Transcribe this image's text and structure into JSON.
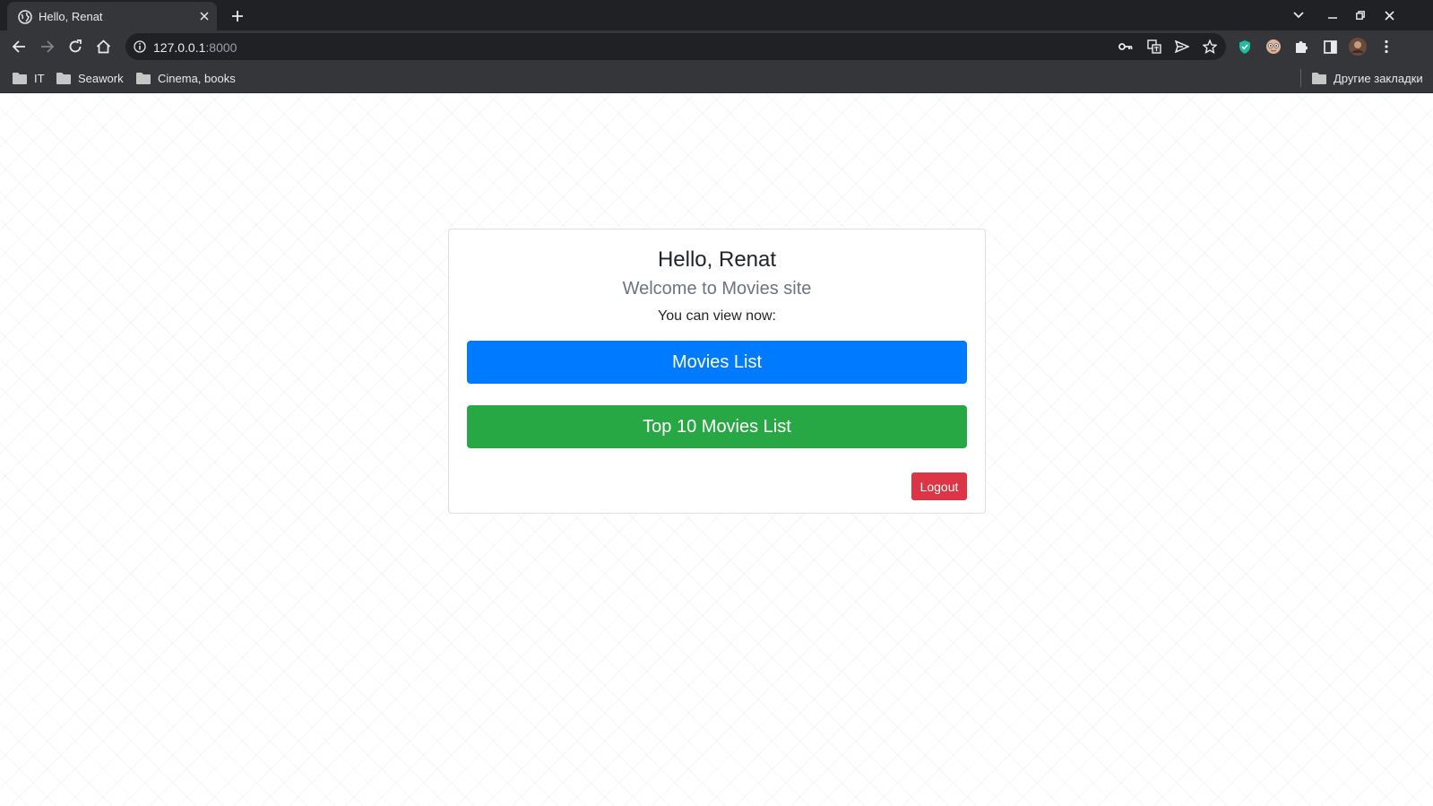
{
  "browser": {
    "tab": {
      "title": "Hello, Renat",
      "favicon": "globe-icon"
    },
    "address_bar": {
      "host": "127.0.0.1",
      "port": ":8000"
    },
    "bookmarks": [
      {
        "label": "IT",
        "icon": "folder-icon"
      },
      {
        "label": "Seawork",
        "icon": "folder-icon"
      },
      {
        "label": "Cinema, books",
        "icon": "folder-icon"
      }
    ],
    "other_bookmarks": "Другие закладки"
  },
  "card": {
    "greeting": "Hello, Renat",
    "welcome": "Welcome to Movies site",
    "view_now": "You can view now:",
    "movies_list_label": "Movies List",
    "top_movies_label": "Top 10 Movies List",
    "logout_label": "Logout"
  },
  "colors": {
    "primary": "#007bff",
    "success": "#28a745",
    "danger": "#dc3545",
    "chrome_dark": "#202124",
    "chrome_toolbar": "#35363a"
  }
}
